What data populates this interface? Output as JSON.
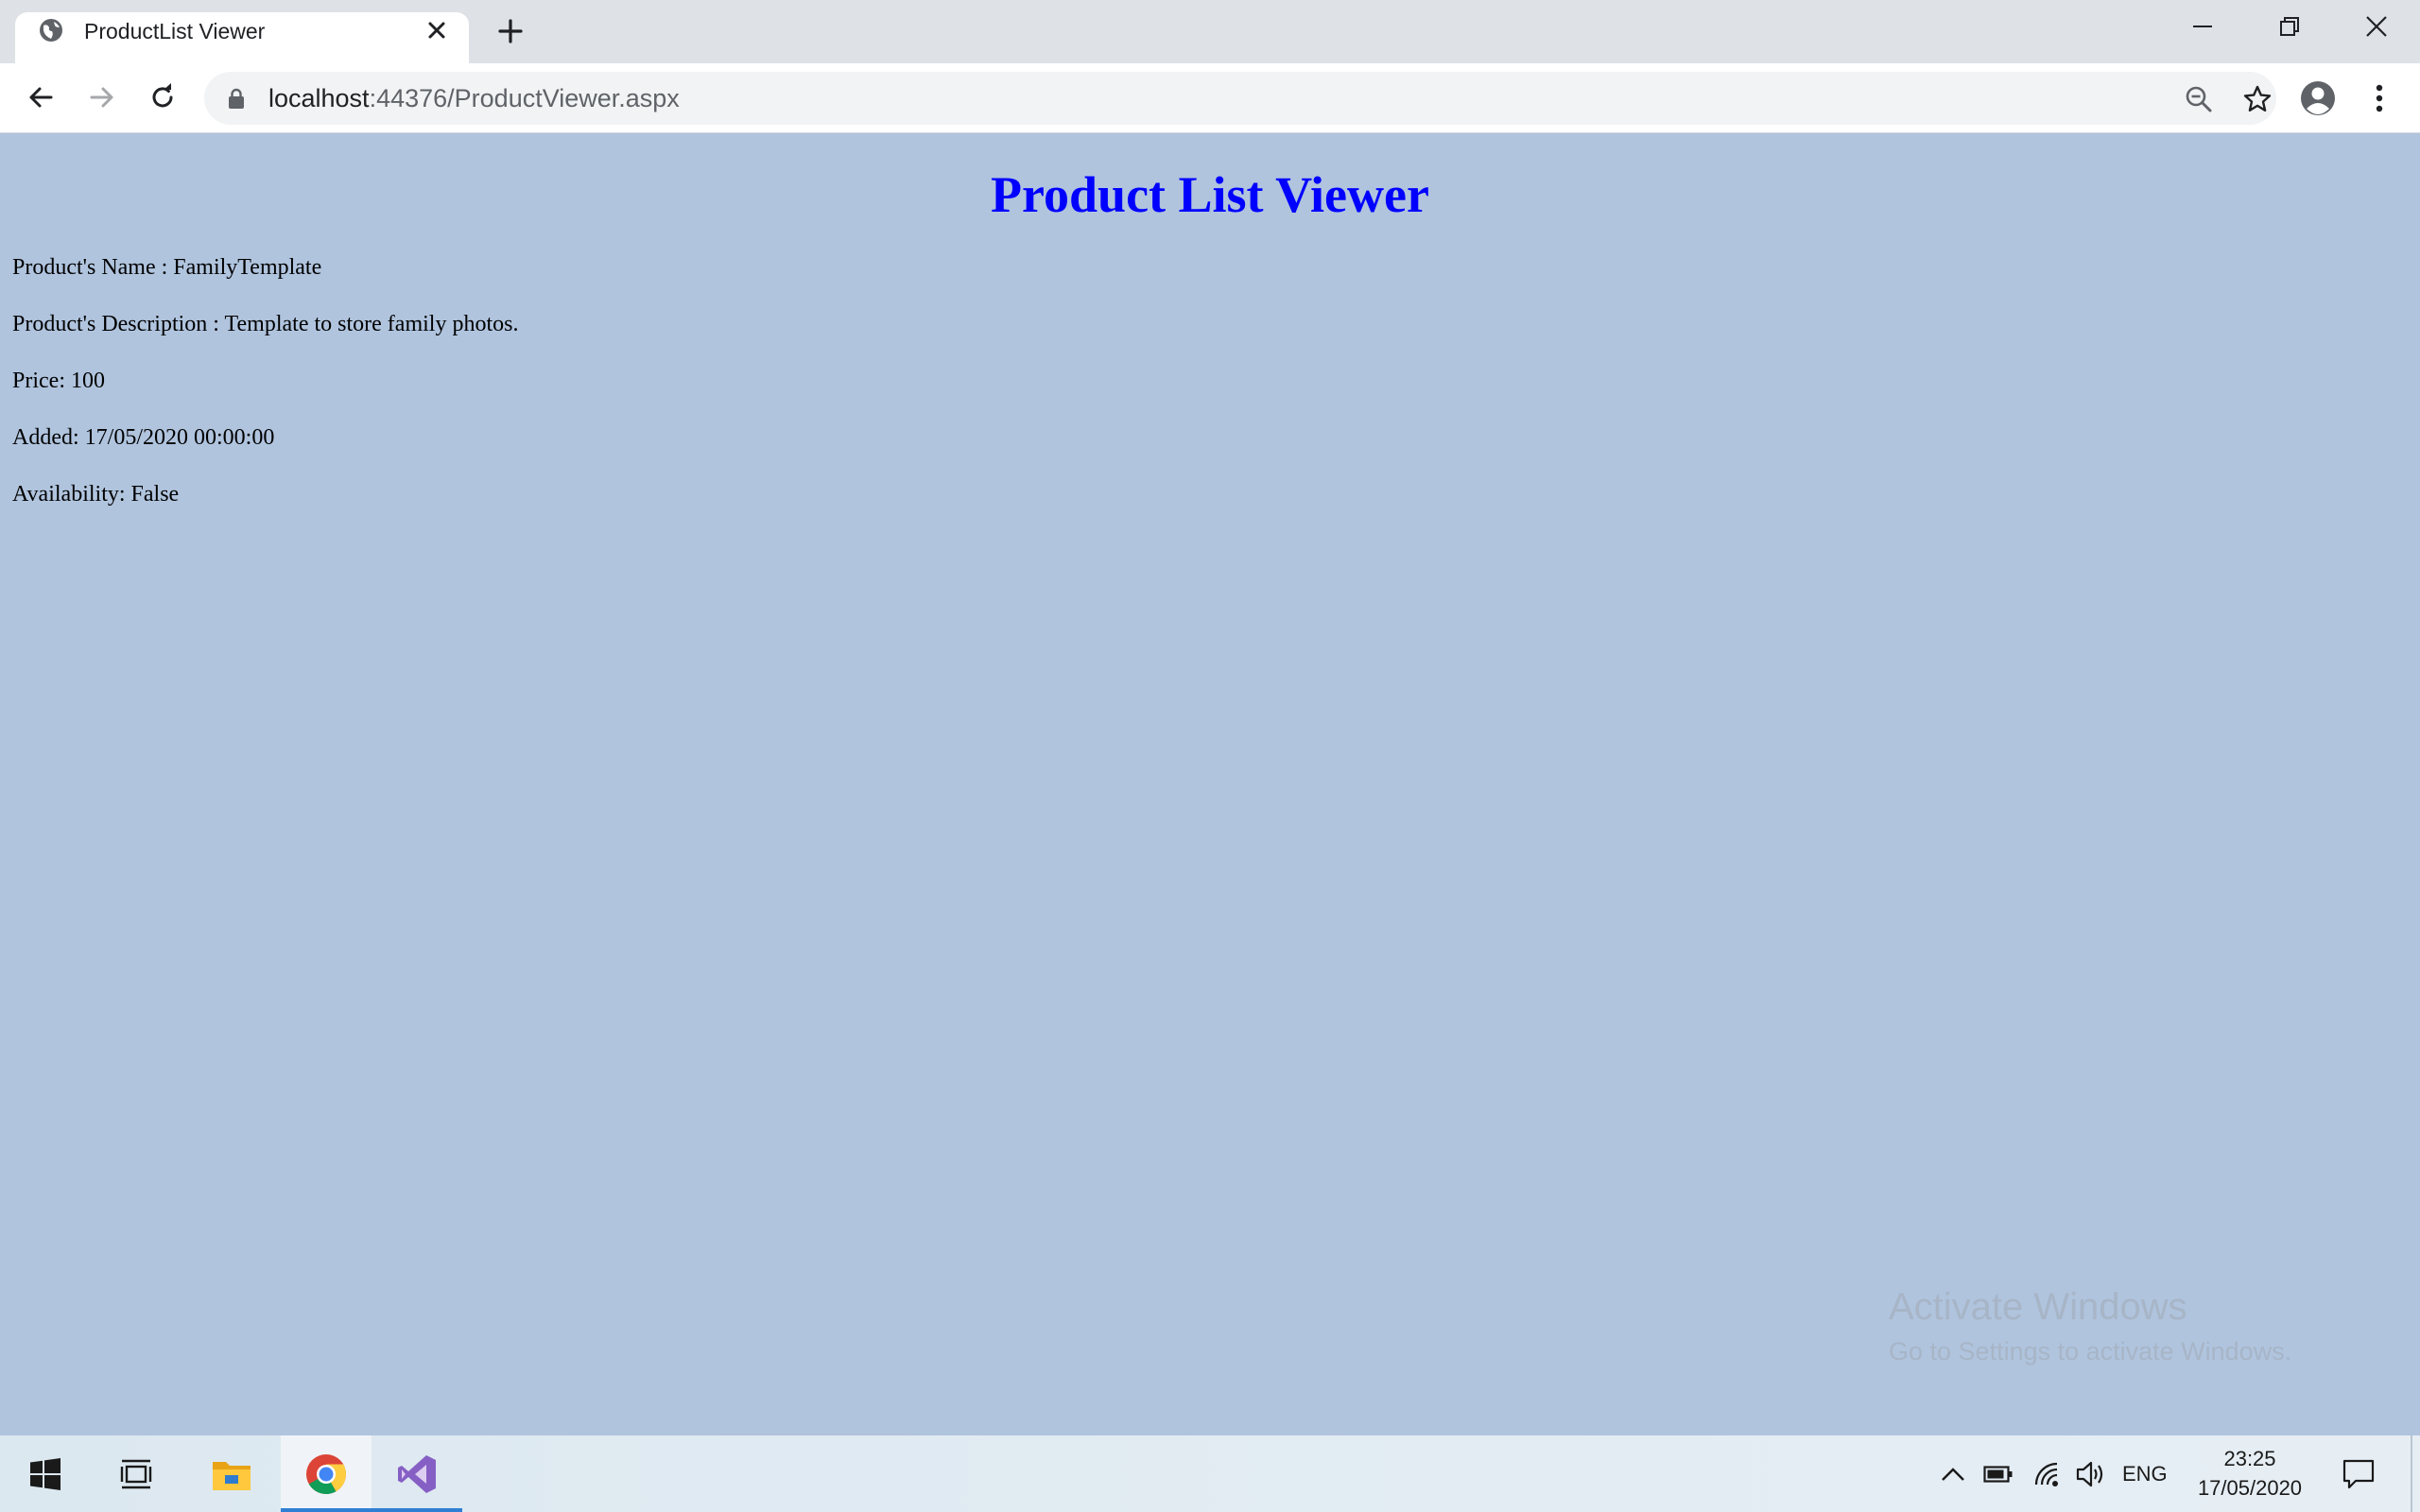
{
  "browser": {
    "tab_title": "ProductList Viewer",
    "url_host": "localhost",
    "url_rest": ":44376/ProductViewer.aspx"
  },
  "page": {
    "heading": "Product List Viewer",
    "product_name": "Product's Name : FamilyTemplate",
    "product_description": "Product's Description : Template to store family photos.",
    "price": "Price: 100",
    "added": "Added: 17/05/2020 00:00:00",
    "availability": "Availability: False"
  },
  "watermark": {
    "line1": "Activate Windows",
    "line2": "Go to Settings to activate Windows."
  },
  "taskbar": {
    "language": "ENG",
    "time": "23:25",
    "date": "17/05/2020"
  },
  "colors": {
    "page_background": "#B0C4DE",
    "heading": "#0000FF"
  }
}
